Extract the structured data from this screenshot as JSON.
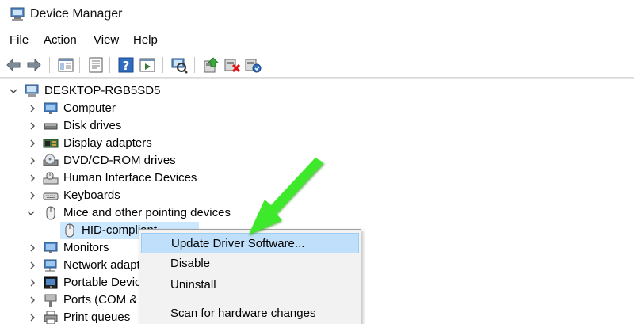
{
  "window": {
    "title": "Device Manager"
  },
  "menu": {
    "file": "File",
    "action": "Action",
    "view": "View",
    "help": "Help"
  },
  "toolbar": {
    "icons": [
      "back-icon",
      "forward-icon",
      "show-hide-tree-icon",
      "properties-icon",
      "help-icon",
      "view-icon",
      "scan-hardware-icon",
      "update-driver-icon",
      "uninstall-icon",
      "enable-device-icon"
    ]
  },
  "tree": {
    "root": "DESKTOP-RGB5SD5",
    "items": [
      {
        "label": "Computer"
      },
      {
        "label": "Disk drives"
      },
      {
        "label": "Display adapters"
      },
      {
        "label": "DVD/CD-ROM drives"
      },
      {
        "label": "Human Interface Devices"
      },
      {
        "label": "Keyboards"
      },
      {
        "label": "Mice and other pointing devices"
      },
      {
        "label": "HID-compliant"
      },
      {
        "label": "Monitors"
      },
      {
        "label": "Network adapt"
      },
      {
        "label": "Portable Devic"
      },
      {
        "label": "Ports (COM &"
      },
      {
        "label": "Print queues"
      }
    ]
  },
  "context_menu": {
    "update": "Update Driver Software...",
    "disable": "Disable",
    "uninstall": "Uninstall",
    "scan": "Scan for hardware changes"
  },
  "colors": {
    "selection": "#cce8ff",
    "menu_highlight": "#bfdffa",
    "arrow": "#3ee82a"
  }
}
